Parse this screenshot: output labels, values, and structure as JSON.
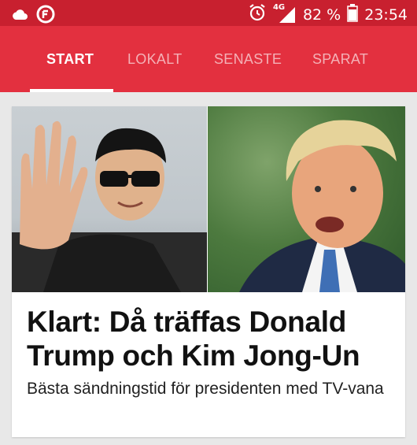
{
  "status": {
    "left_icons": [
      "cloud-icon",
      "firefox-icon"
    ],
    "alarm_icon": "alarm-icon",
    "network": "4G",
    "battery_percent": "82 %",
    "battery_level": 0.82,
    "time": "23:54"
  },
  "colors": {
    "status_bg": "#c8202f",
    "nav_bg": "#e3303f",
    "card_bg": "#ffffff",
    "page_bg": "#e8e8e8"
  },
  "nav": {
    "tabs": [
      {
        "label": "START",
        "active": true
      },
      {
        "label": "LOKALT",
        "active": false
      },
      {
        "label": "SENASTE",
        "active": false
      },
      {
        "label": "SPARAT",
        "active": false
      }
    ]
  },
  "article": {
    "headline": "Klart: Då träffas Donald Trump och Kim Jong-Un",
    "subline": "Bästa sändningstid för presidenten med TV-vana"
  }
}
